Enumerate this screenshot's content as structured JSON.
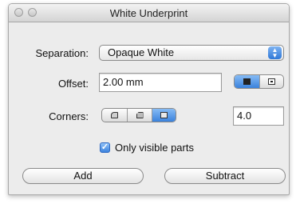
{
  "window": {
    "title": "White Underprint"
  },
  "separation": {
    "label": "Separation:",
    "value": "Opaque White"
  },
  "offset": {
    "label": "Offset:",
    "value": "2.00 mm"
  },
  "corners": {
    "label": "Corners:",
    "value": "4.0"
  },
  "only_visible": {
    "label": "Only visible parts",
    "checked": true
  },
  "buttons": {
    "add": "Add",
    "subtract": "Subtract"
  },
  "colors": {
    "accent": "#3b82dc",
    "window_bg": "#ececec"
  },
  "icons": {
    "offset_modes": [
      "fill-square-icon",
      "inset-square-icon"
    ],
    "corner_modes": [
      "round-corner-icon",
      "bevel-corner-icon",
      "square-corner-icon"
    ]
  }
}
